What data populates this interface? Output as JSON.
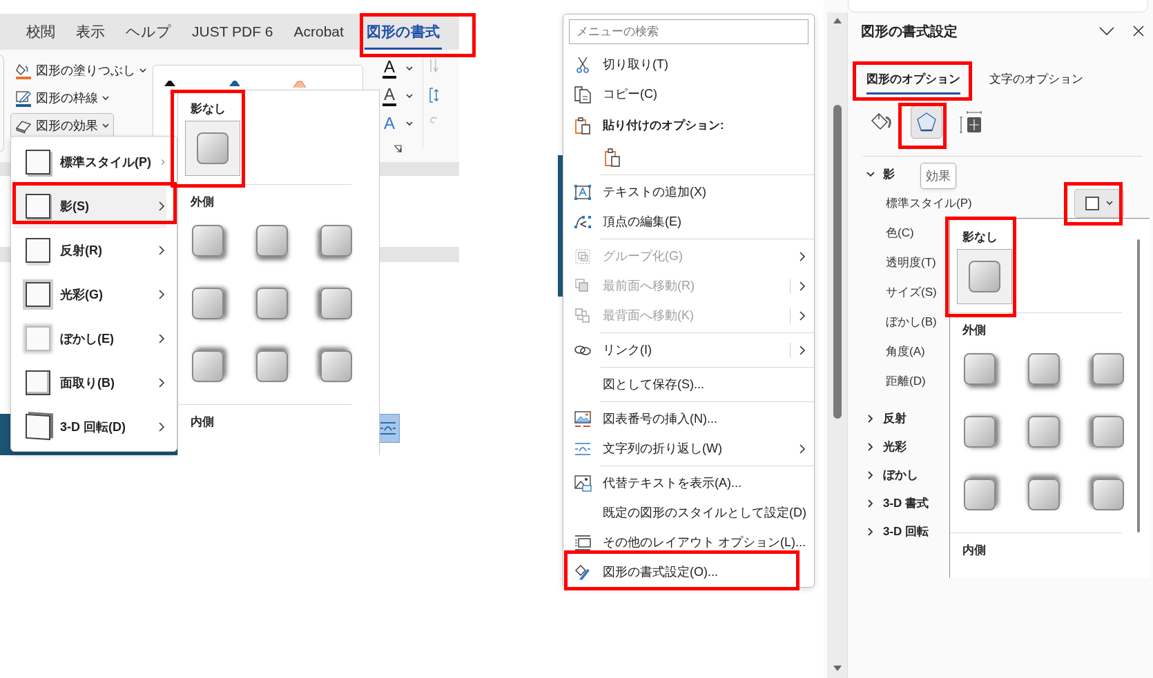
{
  "ribbon": {
    "tabs": [
      {
        "label": "校閲",
        "selected": false
      },
      {
        "label": "表示",
        "selected": false
      },
      {
        "label": "ヘルプ",
        "selected": false
      },
      {
        "label": "JUST PDF 6",
        "selected": false
      },
      {
        "label": "Acrobat",
        "selected": false
      },
      {
        "label": "図形の書式",
        "selected": true
      }
    ],
    "commands": [
      {
        "label": "図形の塗りつぶし",
        "pressed": false
      },
      {
        "label": "図形の枠線",
        "pressed": false
      },
      {
        "label": "図形の効果",
        "pressed": true
      }
    ],
    "text_buttons": [
      "A",
      "A",
      "A"
    ]
  },
  "effects_menu": {
    "items": [
      {
        "label": "標準スタイル(P)",
        "selected": false
      },
      {
        "label": "影(S)",
        "selected": true
      },
      {
        "label": "反射(R)",
        "selected": false
      },
      {
        "label": "光彩(G)",
        "selected": false
      },
      {
        "label": "ぼかし(E)",
        "selected": false
      },
      {
        "label": "面取り(B)",
        "selected": false
      },
      {
        "label": "3-D 回転(D)",
        "selected": false
      }
    ]
  },
  "shadow_gallery": {
    "none_label": "影なし",
    "outer_label": "外側",
    "inner_label": "内側"
  },
  "context_menu": {
    "search": {
      "placeholder": "メニューの検索"
    },
    "items": [
      {
        "kind": "command",
        "label": "切り取り(T)",
        "disabled": false
      },
      {
        "kind": "command",
        "label": "コピー(C)",
        "disabled": false
      },
      {
        "kind": "header",
        "label": "貼り付けのオプション:"
      },
      {
        "kind": "paste_option"
      },
      {
        "kind": "separator"
      },
      {
        "kind": "command",
        "label": "テキストの追加(X)",
        "disabled": false
      },
      {
        "kind": "command",
        "label": "頂点の編集(E)",
        "disabled": false
      },
      {
        "kind": "separator"
      },
      {
        "kind": "command",
        "label": "グループ化(G)",
        "disabled": true,
        "submenu": true,
        "split": false
      },
      {
        "kind": "command",
        "label": "最前面へ移動(R)",
        "disabled": true,
        "submenu": true,
        "split": true
      },
      {
        "kind": "command",
        "label": "最背面へ移動(K)",
        "disabled": true,
        "submenu": true,
        "split": true
      },
      {
        "kind": "separator"
      },
      {
        "kind": "command",
        "label": "リンク(I)",
        "disabled": false,
        "submenu": true,
        "split": true
      },
      {
        "kind": "separator"
      },
      {
        "kind": "command",
        "label": "図として保存(S)...",
        "disabled": false
      },
      {
        "kind": "separator"
      },
      {
        "kind": "command",
        "label": "図表番号の挿入(N)...",
        "disabled": false
      },
      {
        "kind": "command",
        "label": "文字列の折り返し(W)",
        "disabled": false,
        "submenu": true,
        "split": false
      },
      {
        "kind": "separator"
      },
      {
        "kind": "command",
        "label": "代替テキストを表示(A)...",
        "disabled": false
      },
      {
        "kind": "command",
        "label": "既定の図形のスタイルとして設定(D)",
        "disabled": false
      },
      {
        "kind": "command",
        "label": "その他のレイアウト オプション(L)...",
        "disabled": false
      },
      {
        "kind": "command",
        "label": "図形の書式設定(O)...",
        "disabled": false
      }
    ]
  },
  "format_pane": {
    "title": "図形の書式設定",
    "tabs": [
      {
        "label": "図形のオプション",
        "selected": true
      },
      {
        "label": "文字のオプション",
        "selected": false
      }
    ],
    "categories": [
      {
        "selected": false
      },
      {
        "selected": true
      },
      {
        "selected": false
      }
    ],
    "tooltip": "効果",
    "sections": [
      {
        "label": "影",
        "expanded": true,
        "properties": [
          {
            "label": "標準スタイル(P)",
            "kind": "preset"
          },
          {
            "label": "色(C)",
            "kind": "setting"
          },
          {
            "label": "透明度(T)",
            "kind": "setting"
          },
          {
            "label": "サイズ(S)",
            "kind": "setting"
          },
          {
            "label": "ぼかし(B)",
            "kind": "setting"
          },
          {
            "label": "角度(A)",
            "kind": "setting"
          },
          {
            "label": "距離(D)",
            "kind": "setting"
          }
        ]
      },
      {
        "label": "反射",
        "expanded": false
      },
      {
        "label": "光彩",
        "expanded": false
      },
      {
        "label": "ぼかし",
        "expanded": false
      },
      {
        "label": "3-D 書式",
        "expanded": false
      },
      {
        "label": "3-D 回転",
        "expanded": false
      }
    ],
    "gallery": {
      "none_label": "影なし",
      "outer_label": "外側",
      "inner_label": "内側"
    }
  }
}
